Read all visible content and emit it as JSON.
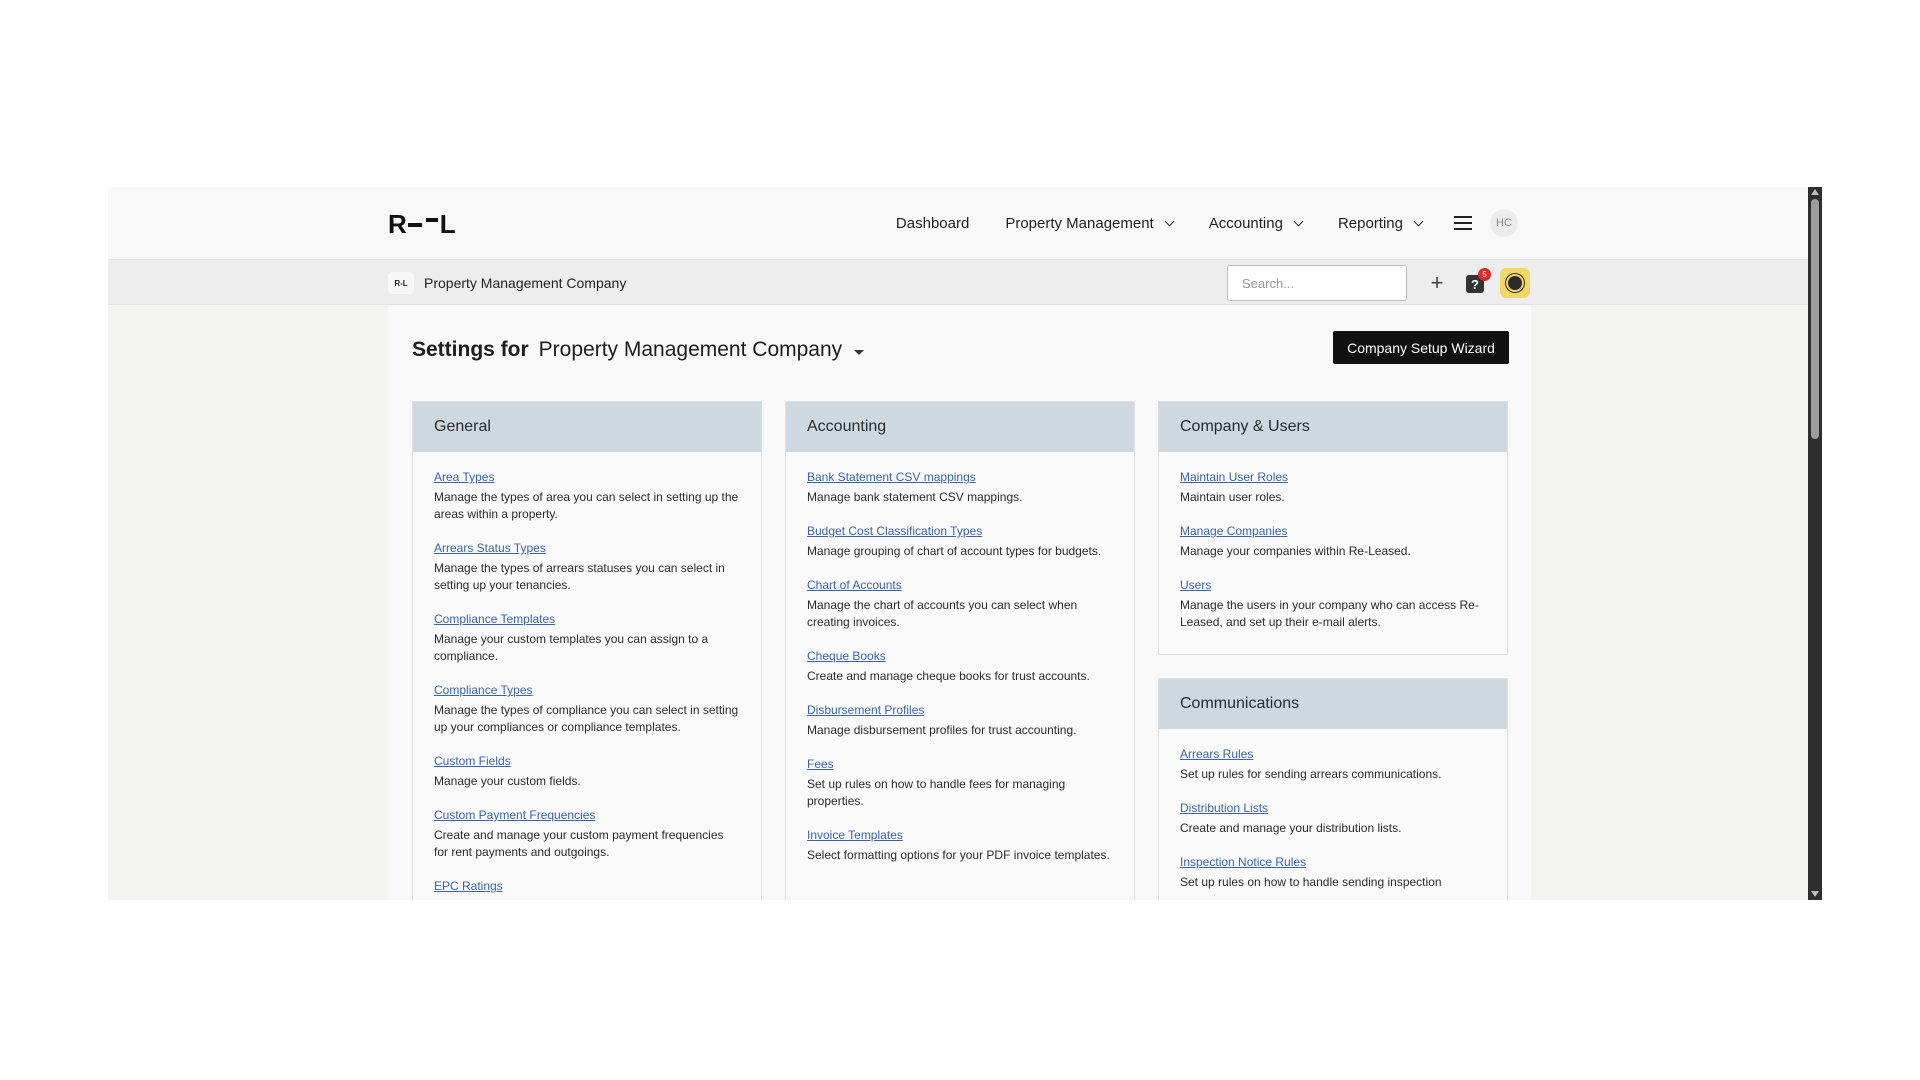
{
  "topnav": {
    "logo_left": "R",
    "logo_right": "L",
    "links": [
      "Dashboard",
      "Property Management",
      "Accounting",
      "Reporting"
    ],
    "avatar_initials": "HC"
  },
  "subbar": {
    "company_logo_text": "R-L",
    "company_name": "Property Management Company",
    "search_placeholder": "Search...",
    "plus_label": "+",
    "help_label": "?",
    "help_badge": "5"
  },
  "page": {
    "settings_label": "Settings for",
    "company_name": "Property Management Company",
    "wizard_button": "Company Setup Wizard"
  },
  "cards": {
    "general": {
      "title": "General",
      "items": [
        {
          "link": "Area Types",
          "desc": "Manage the types of area you can select in setting up the areas within a property."
        },
        {
          "link": "Arrears Status Types",
          "desc": "Manage the types of arrears statuses you can select in setting up your tenancies."
        },
        {
          "link": "Compliance Templates",
          "desc": "Manage your custom templates you can assign to a compliance."
        },
        {
          "link": "Compliance Types",
          "desc": "Manage the types of compliance you can select in setting up your compliances or compliance templates."
        },
        {
          "link": "Custom Fields",
          "desc": "Manage your custom fields."
        },
        {
          "link": "Custom Payment Frequencies",
          "desc": "Create and manage your custom payment frequencies for rent payments and outgoings."
        },
        {
          "link": "EPC Ratings",
          "desc": ""
        }
      ]
    },
    "accounting": {
      "title": "Accounting",
      "items": [
        {
          "link": "Bank Statement CSV mappings",
          "desc": "Manage bank statement CSV mappings."
        },
        {
          "link": "Budget Cost Classification Types",
          "desc": "Manage grouping of chart of account types for budgets."
        },
        {
          "link": "Chart of Accounts",
          "desc": "Manage the chart of accounts you can select when creating invoices."
        },
        {
          "link": "Cheque Books",
          "desc": "Create and manage cheque books for trust accounts."
        },
        {
          "link": "Disbursement Profiles",
          "desc": "Manage disbursement profiles for trust accounting."
        },
        {
          "link": "Fees",
          "desc": "Set up rules on how to handle fees for managing properties."
        },
        {
          "link": "Invoice Templates",
          "desc": "Select formatting options for your PDF invoice templates."
        }
      ]
    },
    "company": {
      "title": "Company & Users",
      "items": [
        {
          "link": "Maintain User Roles",
          "desc": "Maintain user roles."
        },
        {
          "link": "Manage Companies",
          "desc": "Manage your companies within Re-Leased."
        },
        {
          "link": "Users",
          "desc": "Manage the users in your company who can access Re-Leased, and set up their e-mail alerts."
        }
      ]
    },
    "comms": {
      "title": "Communications",
      "items": [
        {
          "link": "Arrears Rules",
          "desc": "Set up rules for sending arrears communications."
        },
        {
          "link": "Distribution Lists",
          "desc": "Create and manage your distribution lists."
        },
        {
          "link": "Inspection Notice Rules",
          "desc": "Set up rules on how to handle sending inspection"
        }
      ]
    }
  }
}
